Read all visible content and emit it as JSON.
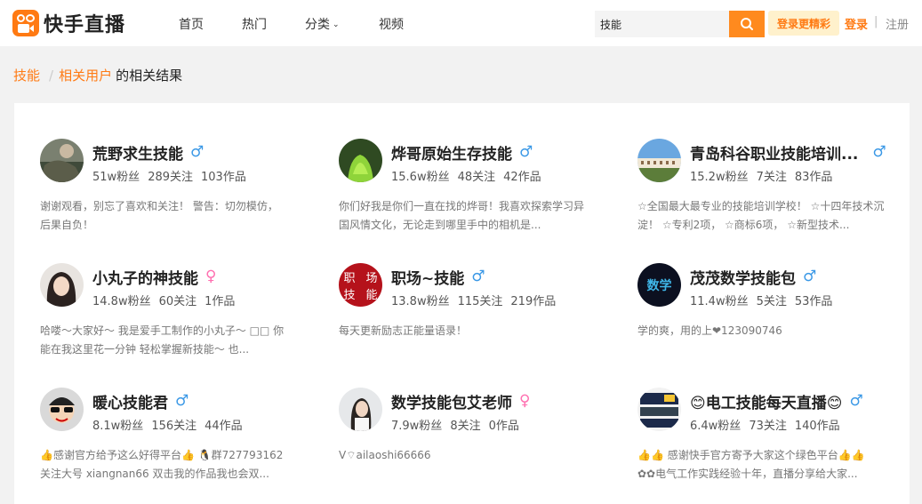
{
  "header": {
    "logo_text": "快手直播",
    "nav": [
      {
        "label": "首页"
      },
      {
        "label": "热门"
      },
      {
        "label": "分类"
      },
      {
        "label": "视频"
      }
    ],
    "search": {
      "value": "技能"
    },
    "promo_label": "登录更精彩",
    "login_label": "登录",
    "separator": "|",
    "register_label": "注册"
  },
  "breadcrumb": {
    "keyword": "技能",
    "category": "相关用户",
    "suffix": "的相关结果"
  },
  "colors": {
    "accent": "#ff7a13",
    "male": "#3a98e6",
    "female": "#ff6fb0"
  },
  "users": [
    {
      "name": "荒野求生技能",
      "gender": "male",
      "gender_symbol": "♂",
      "fans": "51w粉丝",
      "follows": "289关注",
      "works": "103作品",
      "desc": "谢谢观看，别忘了喜欢和关注！ 警告：切勿模仿，后果自负！"
    },
    {
      "name": "烨哥原始生存技能",
      "gender": "male",
      "gender_symbol": "♂",
      "fans": "15.6w粉丝",
      "follows": "48关注",
      "works": "42作品",
      "desc": "你们好我是你们一直在找的烨哥！我喜欢探索学习异国风情文化，无论走到哪里手中的相机是..."
    },
    {
      "name": "青岛科谷职业技能培训...",
      "gender": "male",
      "gender_symbol": "♂",
      "fans": "15.2w粉丝",
      "follows": "7关注",
      "works": "83作品",
      "desc": "☆全国最大最专业的技能培训学校！ ☆十四年技术沉淀！ ☆专利2项， ☆商标6项， ☆新型技术..."
    },
    {
      "name": "小丸子的神技能",
      "gender": "female",
      "gender_symbol": "♀",
      "fans": "14.8w粉丝",
      "follows": "60关注",
      "works": "1作品",
      "desc": "哈喽～大家好～ 我是爱手工制作的小丸子～ □□ 你能在我这里花一分钟 轻松掌握新技能～ 也..."
    },
    {
      "name": "职场~技能",
      "gender": "male",
      "gender_symbol": "♂",
      "fans": "13.8w粉丝",
      "follows": "115关注",
      "works": "219作品",
      "desc": "每天更新励志正能量语录！"
    },
    {
      "name": "茂茂数学技能包",
      "gender": "male",
      "gender_symbol": "♂",
      "fans": "11.4w粉丝",
      "follows": "5关注",
      "works": "53作品",
      "desc": "学的爽，用的上❤123090746"
    },
    {
      "name": "暖心技能君",
      "gender": "male",
      "gender_symbol": "♂",
      "fans": "8.1w粉丝",
      "follows": "156关注",
      "works": "44作品",
      "desc": "👍感谢官方给予这么好得平台👍 🐧群727793162 关注大号 xiangnan66 双击我的作品我也会双..."
    },
    {
      "name": "数学技能包艾老师",
      "gender": "female",
      "gender_symbol": "♀",
      "fans": "7.9w粉丝",
      "follows": "8关注",
      "works": "0作品",
      "desc": "V⌔ailaoshi66666"
    },
    {
      "name": "😊电工技能每天直播😊",
      "gender": "male",
      "gender_symbol": "♂",
      "fans": "6.4w粉丝",
      "follows": "73关注",
      "works": "140作品",
      "desc": "👍👍 感谢快手官方寄予大家这个绿色平台👍👍 ✿✿电气工作实践经验十年，直播分享给大家..."
    }
  ],
  "avatar_texts": {
    "workplace": [
      "职",
      "场",
      "技",
      "能"
    ],
    "math_badge": "数学"
  }
}
